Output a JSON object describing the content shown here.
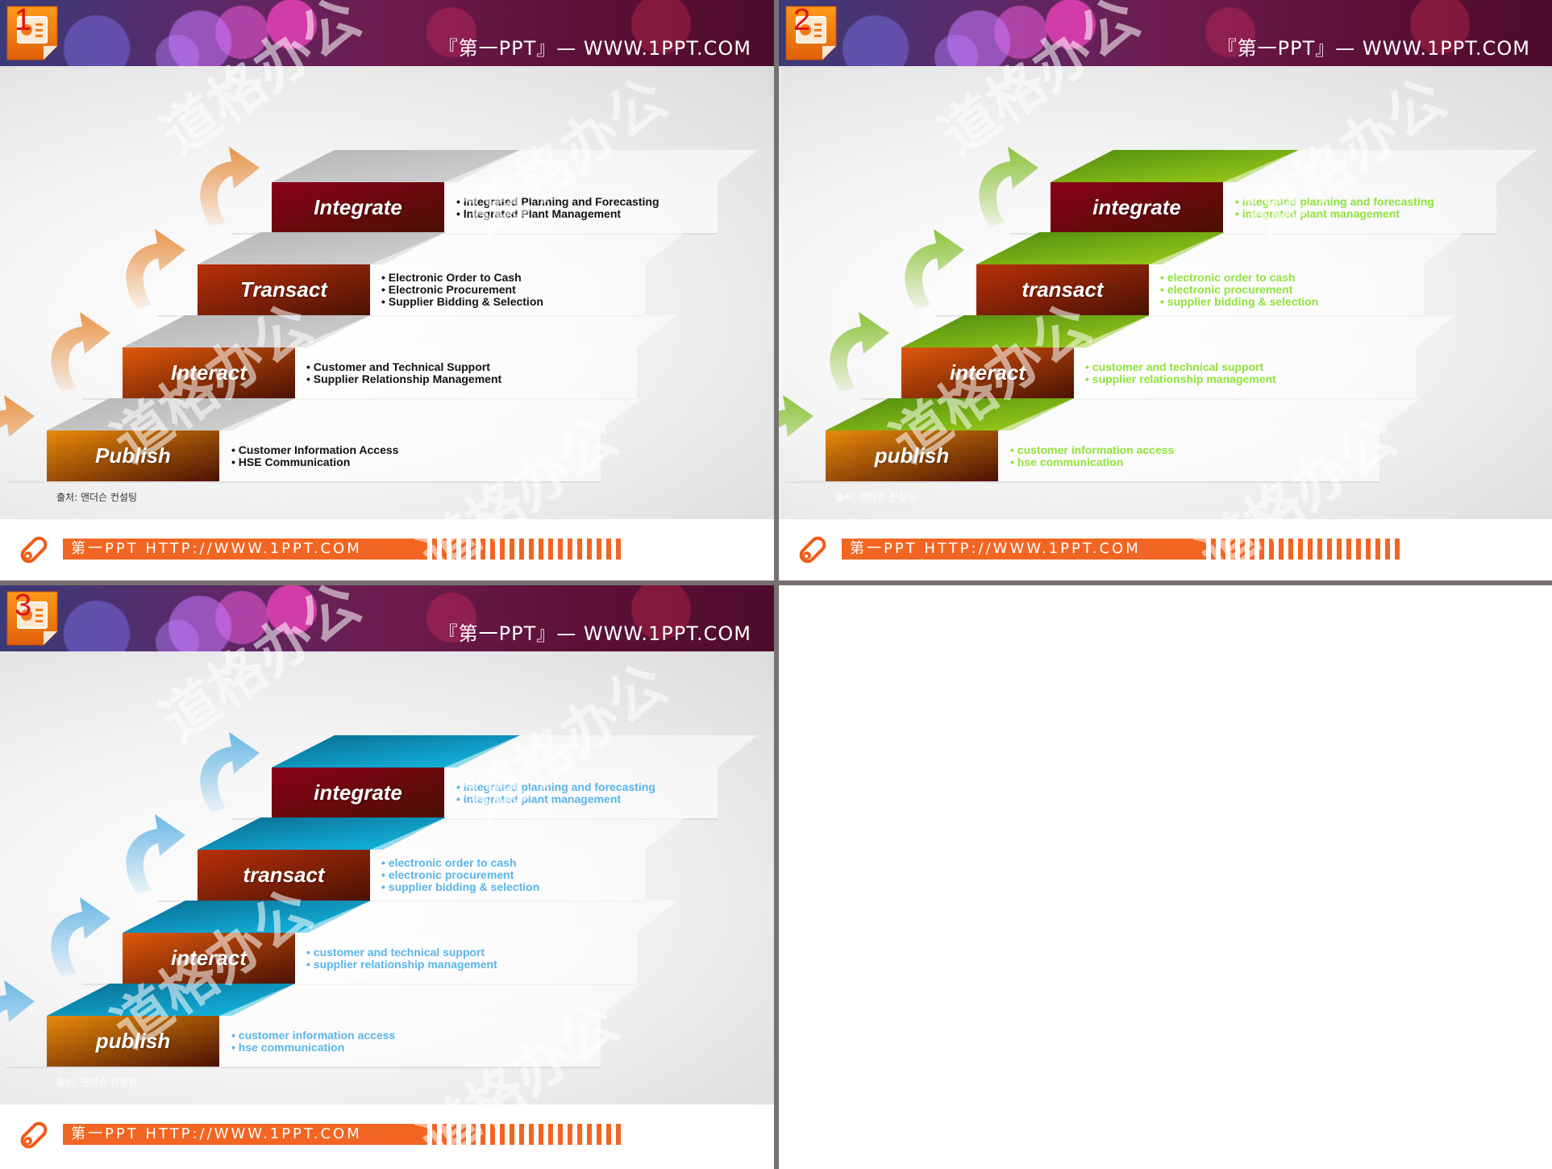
{
  "banner": {
    "title": "『第一PPT』— WWW.1PPT.COM"
  },
  "footer": {
    "text": "第一PPT HTTP://WWW.1PPT.COM"
  },
  "source_note": "출처: 앤더슨 컨설팅",
  "watermark": "道格办公",
  "slides": [
    {
      "number": "1",
      "theme": "gray",
      "colors": {
        "tread": "#b5b5b5",
        "tread_light": "#d2d2d2",
        "arrow": "#e9954a",
        "desc": "#111111"
      },
      "steps": [
        {
          "label": "Integrate",
          "items": [
            "Integrated Planning and Forecasting",
            "Integrated Plant Management"
          ]
        },
        {
          "label": "Transact",
          "items": [
            "Electronic Order to Cash",
            "Electronic Procurement",
            "Supplier Bidding & Selection"
          ]
        },
        {
          "label": "Interact",
          "items": [
            "Customer and  Technical Support",
            "Supplier Relationship Management"
          ]
        },
        {
          "label": "Publish",
          "items": [
            "Customer Information  Access",
            "HSE Communication"
          ]
        }
      ]
    },
    {
      "number": "2",
      "theme": "green",
      "colors": {
        "tread": "#4e8a10",
        "tread_light": "#9ed01a",
        "arrow": "#8cc43a",
        "desc": "#8ee43a"
      },
      "steps": [
        {
          "label": "integrate",
          "items": [
            "integrated planning and forecasting",
            "integrated plant management"
          ]
        },
        {
          "label": "transact",
          "items": [
            "electronic order to cash",
            "electronic procurement",
            "supplier bidding & selection"
          ]
        },
        {
          "label": "interact",
          "items": [
            "customer and technical support",
            "supplier relationship management"
          ]
        },
        {
          "label": "publish",
          "items": [
            "customer information access",
            "hse communication"
          ]
        }
      ]
    },
    {
      "number": "3",
      "theme": "blue",
      "colors": {
        "tread": "#0a6a8e",
        "tread_light": "#12bde8",
        "arrow": "#6ab8e6",
        "desc": "#5ab4ea"
      },
      "steps": [
        {
          "label": "integrate",
          "items": [
            "integrated planning and forecasting",
            "integrated plant management"
          ]
        },
        {
          "label": "transact",
          "items": [
            "electronic order to cash",
            "electronic procurement",
            "supplier bidding & selection"
          ]
        },
        {
          "label": "interact",
          "items": [
            "customer and technical support",
            "supplier relationship management"
          ]
        },
        {
          "label": "publish",
          "items": [
            "customer information access",
            "hse communication"
          ]
        }
      ]
    }
  ],
  "step_colors": [
    "#8a0018",
    "#b8300a",
    "#e0580a",
    "#e88a0a"
  ]
}
